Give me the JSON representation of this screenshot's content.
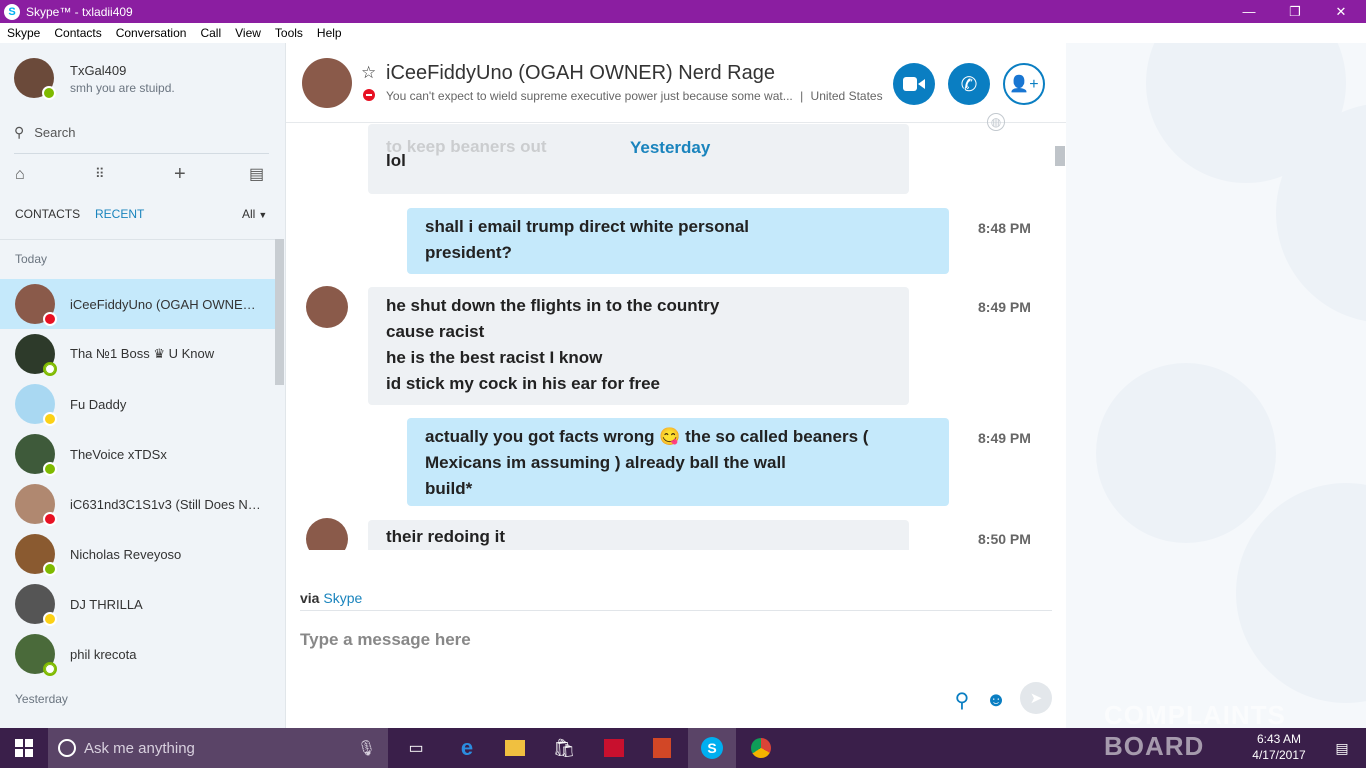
{
  "window": {
    "title": "Skype™ - txladii409"
  },
  "menu": [
    "Skype",
    "Contacts",
    "Conversation",
    "Call",
    "View",
    "Tools",
    "Help"
  ],
  "me": {
    "name": "TxGal409",
    "mood": "smh you are stuipd."
  },
  "sidebar": {
    "search_label": "Search",
    "tab_contacts": "CONTACTS",
    "tab_recent": "RECENT",
    "filter": "All",
    "section_today": "Today",
    "section_yesterday": "Yesterday",
    "contacts": [
      {
        "name": "iCeeFiddyUno (OGAH OWNER)...",
        "status": "busy",
        "color": "#8a5a4a"
      },
      {
        "name": "Tha №1 Boss ♛ U Know",
        "status": "offline",
        "color": "#2d3a2a"
      },
      {
        "name": "Fu Daddy",
        "status": "away",
        "color": "#a9d8f2"
      },
      {
        "name": "TheVoice xTDSx",
        "status": "online",
        "color": "#3e5a3a"
      },
      {
        "name": "iC631nd3C1S1v3 (Still Does No...",
        "status": "busy",
        "color": "#b08870"
      },
      {
        "name": "Nicholas Reveyoso",
        "status": "online",
        "color": "#8a5a30"
      },
      {
        "name": "DJ THRILLA",
        "status": "away",
        "color": "#555"
      },
      {
        "name": "phil krecota",
        "status": "offline",
        "color": "#4a6a3a"
      }
    ]
  },
  "header": {
    "name": "iCeeFiddyUno (OGAH OWNER) Nerd Rage",
    "mood": "You can't expect to wield supreme executive power just because some wat...",
    "location": "United States"
  },
  "chat": {
    "day_label": "Yesterday",
    "partial_top": [
      "to keep beaners out",
      "lol"
    ],
    "messages": [
      {
        "dir": "out",
        "lines": [
          "shall  i email  trump direct  white  personal",
          "president?"
        ],
        "time": "8:48 PM"
      },
      {
        "dir": "in",
        "lines": [
          "he shut down the flights in to the country",
          "cause racist",
          "he is the best racist I know",
          "id stick my cock in his ear for free"
        ],
        "time": "8:49 PM"
      },
      {
        "dir": "out",
        "lines": [
          "actually   you got facts wrong 😋 the so called beaners (",
          "Mexicans im assuming )  already ball the wall",
          "build*"
        ],
        "time": "8:49 PM"
      },
      {
        "dir": "in",
        "lines": [
          "their redoing it"
        ],
        "time": "8:50 PM"
      }
    ]
  },
  "composer": {
    "via": "via",
    "via_link": "Skype",
    "placeholder": "Type a message here"
  },
  "taskbar": {
    "search": "Ask me anything",
    "time": "6:43 AM",
    "date": "4/17/2017",
    "watermark": "COMPLAINTS BOARD"
  },
  "colors": {
    "titlebar": "#8b1ea1",
    "accent": "#0a7ec2",
    "bubble_out": "#c5e9fb",
    "bubble_in": "#eef1f4"
  }
}
